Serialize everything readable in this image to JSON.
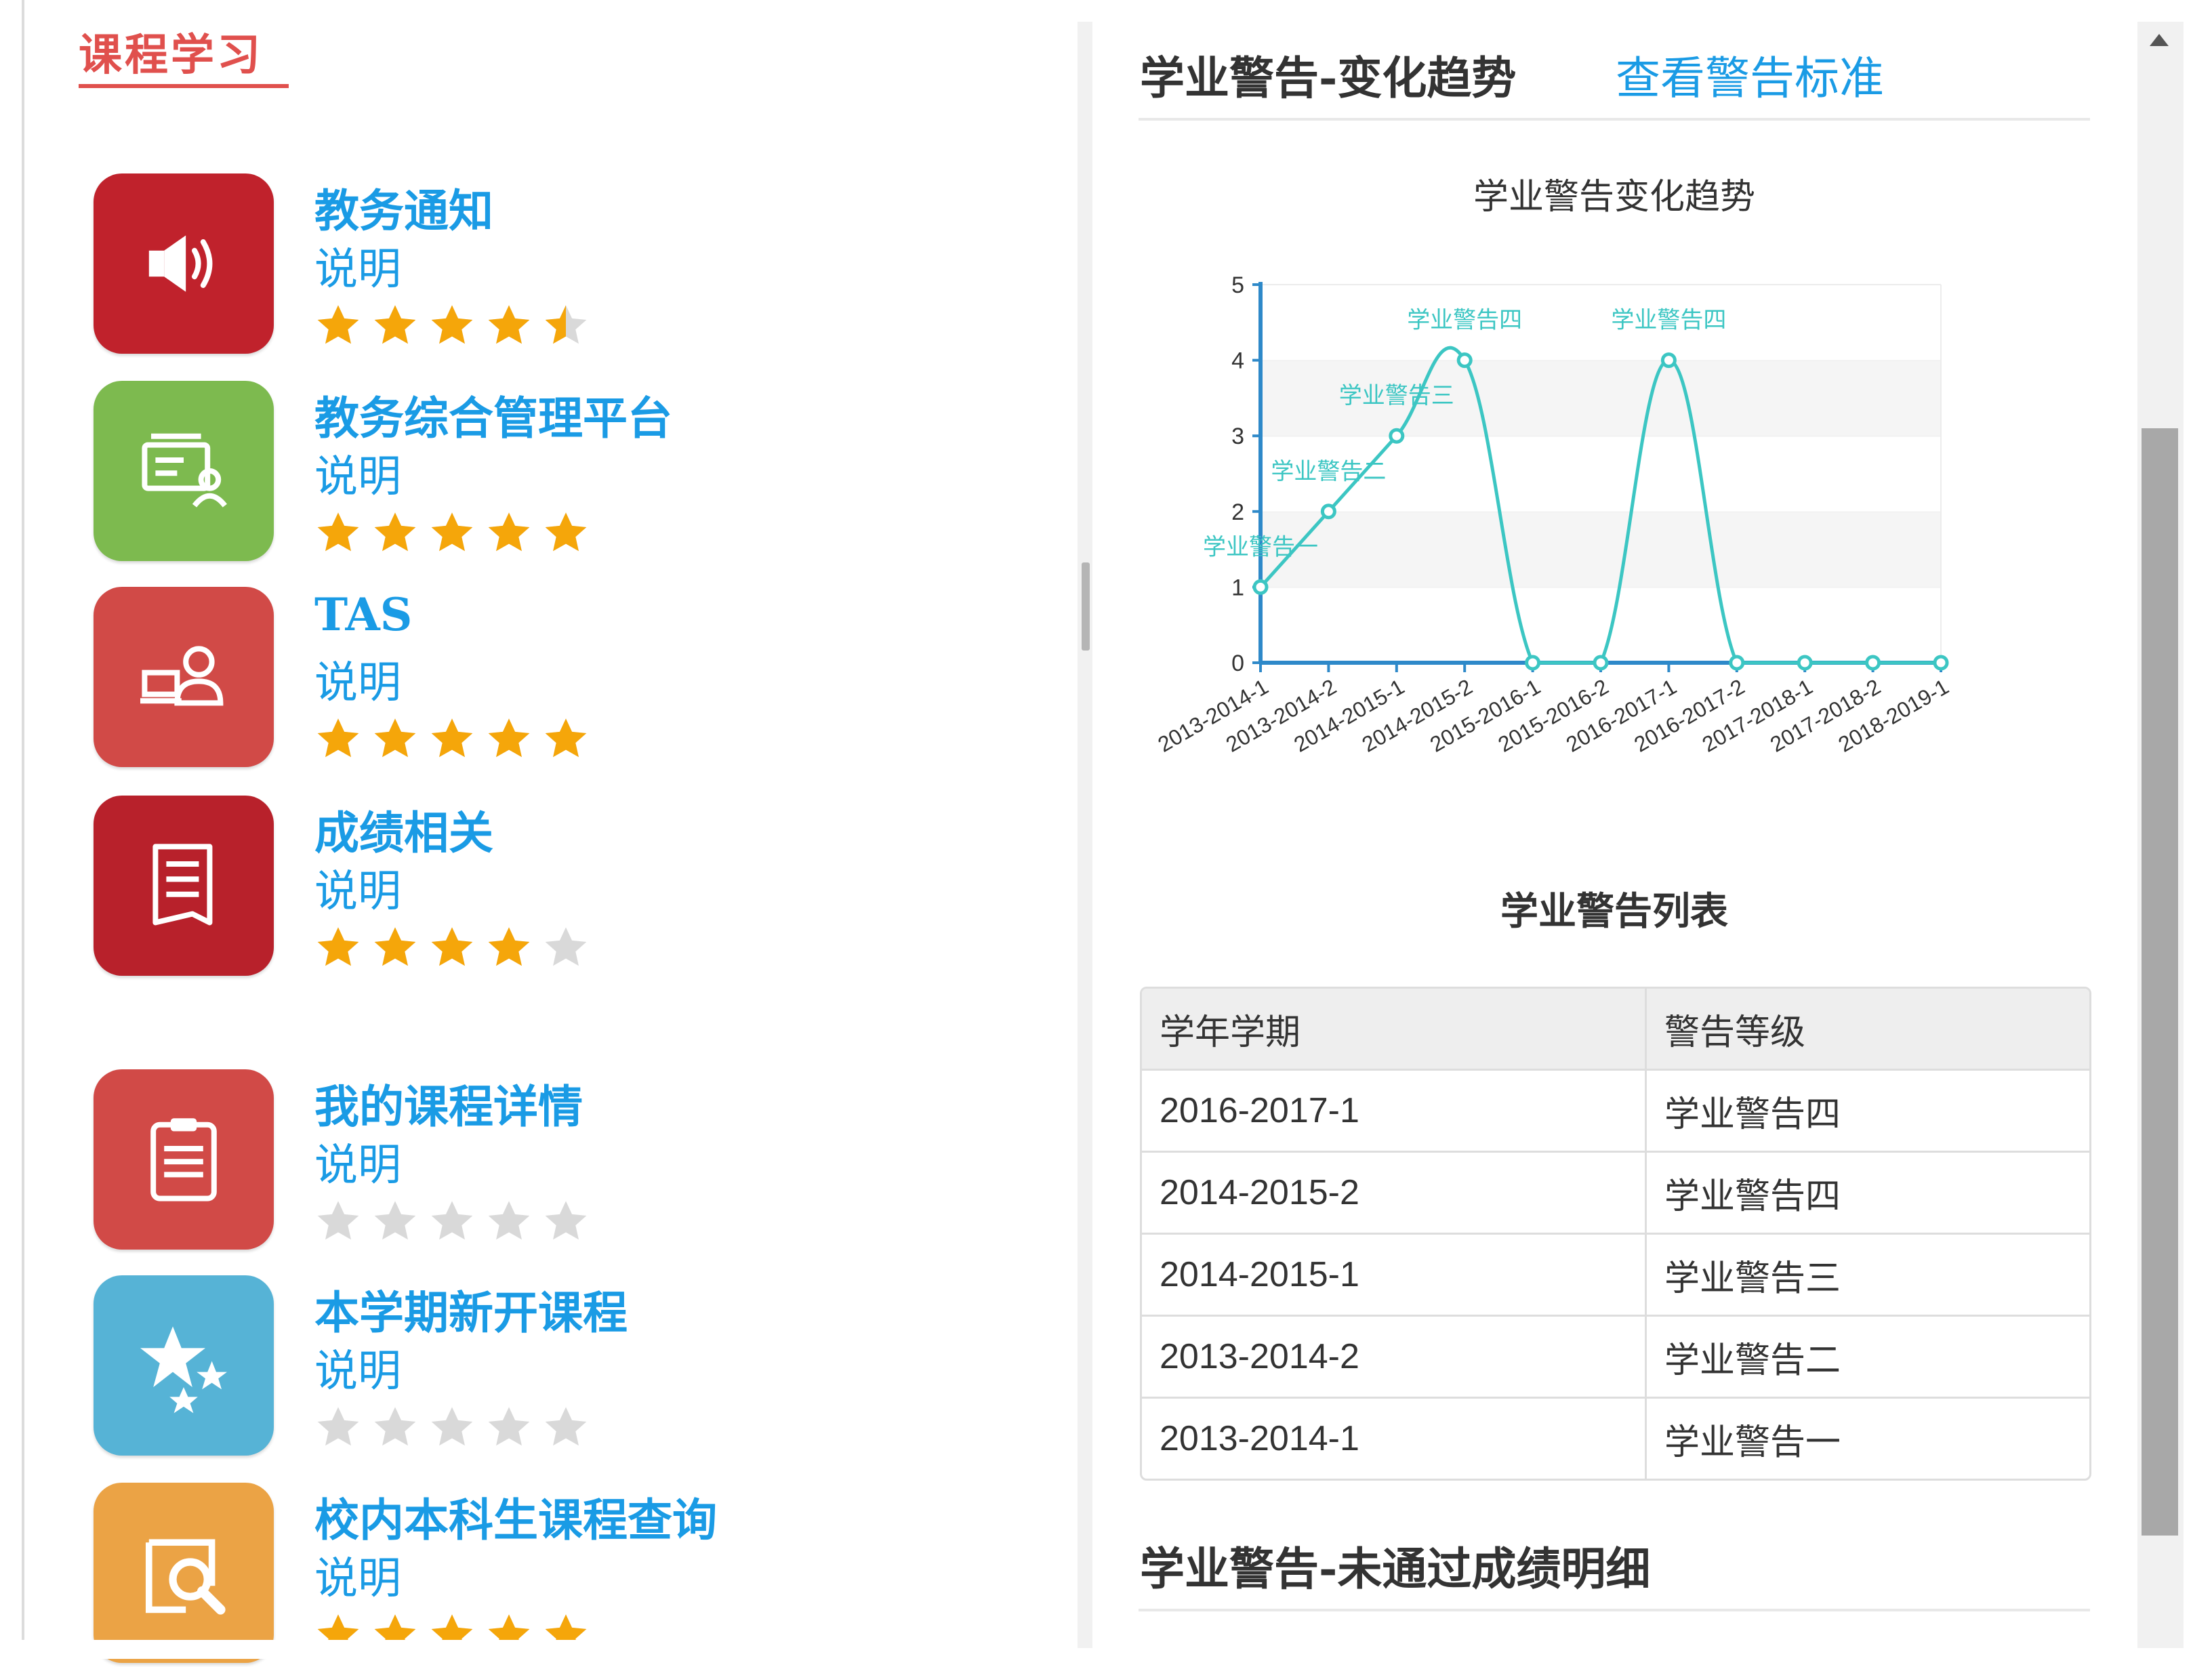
{
  "left": {
    "section_tab": "课程学习",
    "apps": [
      {
        "title": "教务通知",
        "desc": "说明",
        "rating": 4.5,
        "icon": "megaphone-icon",
        "color": "#c0222c"
      },
      {
        "title": "教务综合管理平台",
        "desc": "说明",
        "rating": 5,
        "icon": "presentation-icon",
        "color": "#7dba4f"
      },
      {
        "title": "TAS",
        "desc": "说明",
        "rating": 5,
        "icon": "user-at-laptop-icon",
        "color": "#d14a47"
      },
      {
        "title": "成绩相关",
        "desc": "说明",
        "rating": 4,
        "icon": "document-icon",
        "color": "#b8212b"
      },
      {
        "title": "我的课程详情",
        "desc": "说明",
        "rating": 0,
        "icon": "clipboard-icon",
        "color": "#d14a47"
      },
      {
        "title": "本学期新开课程",
        "desc": "说明",
        "rating": 0,
        "icon": "stars-icon",
        "color": "#56b3d6"
      },
      {
        "title": "校内本科生课程查询",
        "desc": "说明",
        "rating": 5,
        "icon": "search-book-icon",
        "color": "#eba345"
      }
    ]
  },
  "right": {
    "trend_title": "学业警告-变化趋势",
    "view_standard_link": "查看警告标准",
    "list_title": "学业警告列表",
    "table": {
      "headers": [
        "学年学期",
        "警告等级"
      ],
      "rows": [
        [
          "2016-2017-1",
          "学业警告四"
        ],
        [
          "2014-2015-2",
          "学业警告四"
        ],
        [
          "2014-2015-1",
          "学业警告三"
        ],
        [
          "2013-2014-2",
          "学业警告二"
        ],
        [
          "2013-2014-1",
          "学业警告一"
        ]
      ]
    },
    "detail_title": "学业警告-未通过成绩明细"
  },
  "colors": {
    "link": "#1a9be5",
    "accent": "#e0504d",
    "series": "#3cc6c3",
    "axis": "#2e89c9",
    "star": "#f5a60a",
    "star_empty": "#d9d9d9"
  },
  "chart_data": {
    "type": "line",
    "title": "学业警告变化趋势",
    "categories": [
      "2013-2014-1",
      "2013-2014-2",
      "2014-2015-1",
      "2014-2015-2",
      "2015-2016-1",
      "2015-2016-2",
      "2016-2017-1",
      "2016-2017-2",
      "2017-2018-1",
      "2017-2018-2",
      "2018-2019-1"
    ],
    "values": [
      1,
      2,
      3,
      4,
      0,
      0,
      4,
      0,
      0,
      0,
      0
    ],
    "point_labels": [
      "学业警告一",
      "学业警告二",
      "学业警告三",
      "学业警告四",
      "",
      "",
      "学业警告四",
      "",
      "",
      "",
      ""
    ],
    "ylim": [
      0,
      5
    ],
    "yticks": [
      0,
      1,
      2,
      3,
      4,
      5
    ],
    "smooth": true,
    "xlabel": "",
    "ylabel": "",
    "legend": "none"
  }
}
